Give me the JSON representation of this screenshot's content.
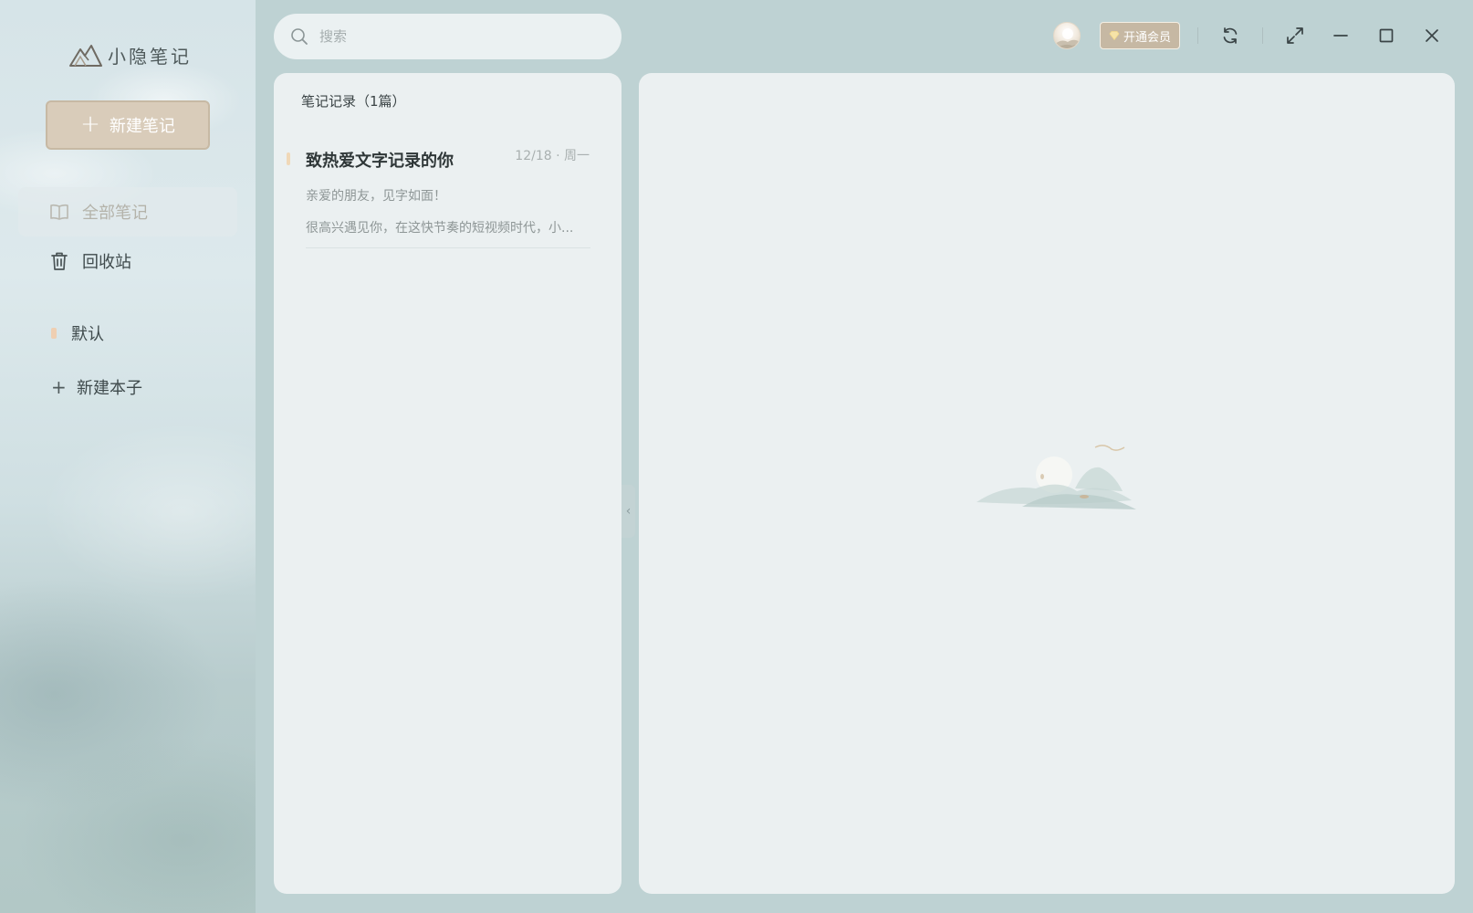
{
  "app": {
    "name": "小隐笔记"
  },
  "sidebar": {
    "new_note_label": "新建笔记",
    "nav": [
      {
        "label": "全部笔记",
        "icon": "book-icon",
        "active": true
      },
      {
        "label": "回收站",
        "icon": "trash-icon",
        "active": false
      }
    ],
    "notebooks": [
      {
        "label": "默认",
        "marker_color": "#efcfb2"
      }
    ],
    "new_notebook_label": "新建本子"
  },
  "topbar": {
    "search_placeholder": "搜索",
    "vip_label": "开通会员",
    "icons": [
      "sync-icon",
      "fullscreen-icon",
      "minimize-icon",
      "maximize-icon",
      "close-icon"
    ]
  },
  "note_list": {
    "header": "笔记记录（1篇）",
    "notes": [
      {
        "title": "致热爱文字记录的你",
        "date": "12/18 · 周一",
        "line1": "亲爱的朋友，见字如面！",
        "line2": "很高兴遇见你，在这快节奏的短视频时代，小..."
      }
    ]
  },
  "colors": {
    "background": "#bed2d3",
    "panel": "#ebf0f1",
    "accent": "#d9ccba",
    "vip": "#c6b8a3"
  }
}
